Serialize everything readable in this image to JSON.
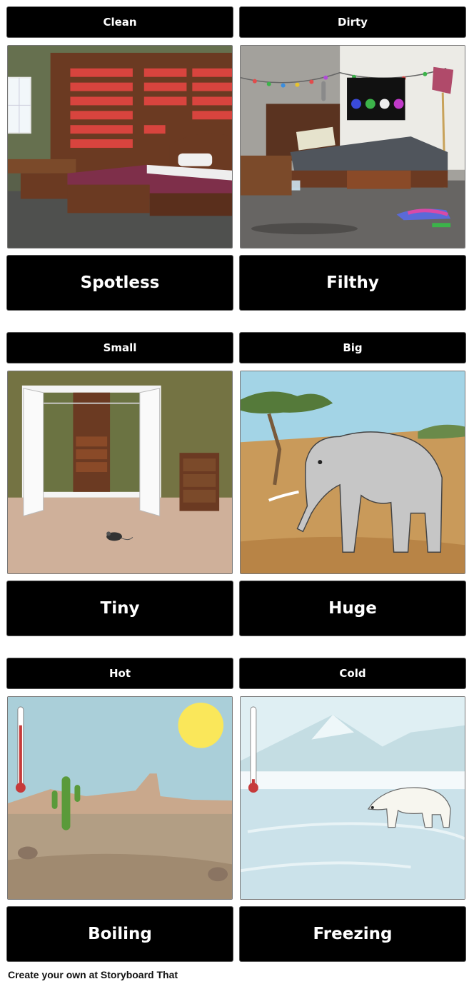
{
  "panels": [
    {
      "title": "Clean",
      "word": "Spotless",
      "scene": "tidy-bedroom"
    },
    {
      "title": "Dirty",
      "word": "Filthy",
      "scene": "messy-bedroom"
    },
    {
      "title": "Small",
      "word": "Tiny",
      "scene": "closet-with-mouse"
    },
    {
      "title": "Big",
      "word": "Huge",
      "scene": "elephant-savanna"
    },
    {
      "title": "Hot",
      "word": "Boiling",
      "scene": "desert-with-sun"
    },
    {
      "title": "Cold",
      "word": "Freezing",
      "scene": "polar-bear-ice"
    }
  ],
  "footer": {
    "text": "Create your own at Storyboard That"
  }
}
